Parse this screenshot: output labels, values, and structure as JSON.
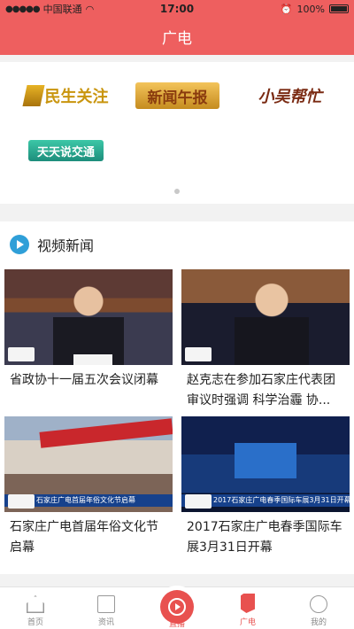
{
  "status_bar": {
    "carrier": "中国联通",
    "time": "17:00",
    "battery": "100%"
  },
  "header": {
    "title": "广电"
  },
  "programs": [
    {
      "name": "民生关注"
    },
    {
      "name": "新闻午报"
    },
    {
      "name": "小吴帮忙"
    },
    {
      "name": "天天说交通"
    }
  ],
  "video_news": {
    "title": "视频新闻",
    "items": [
      {
        "title": "省政协十一届五次会议闭幕"
      },
      {
        "title": "赵克志在参加石家庄代表团审议时强调 科学治霾 协..."
      },
      {
        "title": "石家庄广电首届年俗文化节启幕",
        "ticker": "石家庄广电首届年俗文化节启幕"
      },
      {
        "title": "2017石家庄广电春季国际车展3月31日开幕",
        "ticker": "2017石家庄广电春季国际车展3月31日开幕"
      }
    ]
  },
  "tabs": [
    {
      "label": "首页",
      "icon": "home-icon"
    },
    {
      "label": "资讯",
      "icon": "news-icon"
    },
    {
      "label": "直播",
      "icon": "live-icon"
    },
    {
      "label": "广电",
      "icon": "broadcast-icon"
    },
    {
      "label": "我的",
      "icon": "user-icon"
    }
  ],
  "colors": {
    "brand": "#ee5f5f",
    "accent": "#e8514f",
    "video_icon": "#2f9fd8"
  }
}
